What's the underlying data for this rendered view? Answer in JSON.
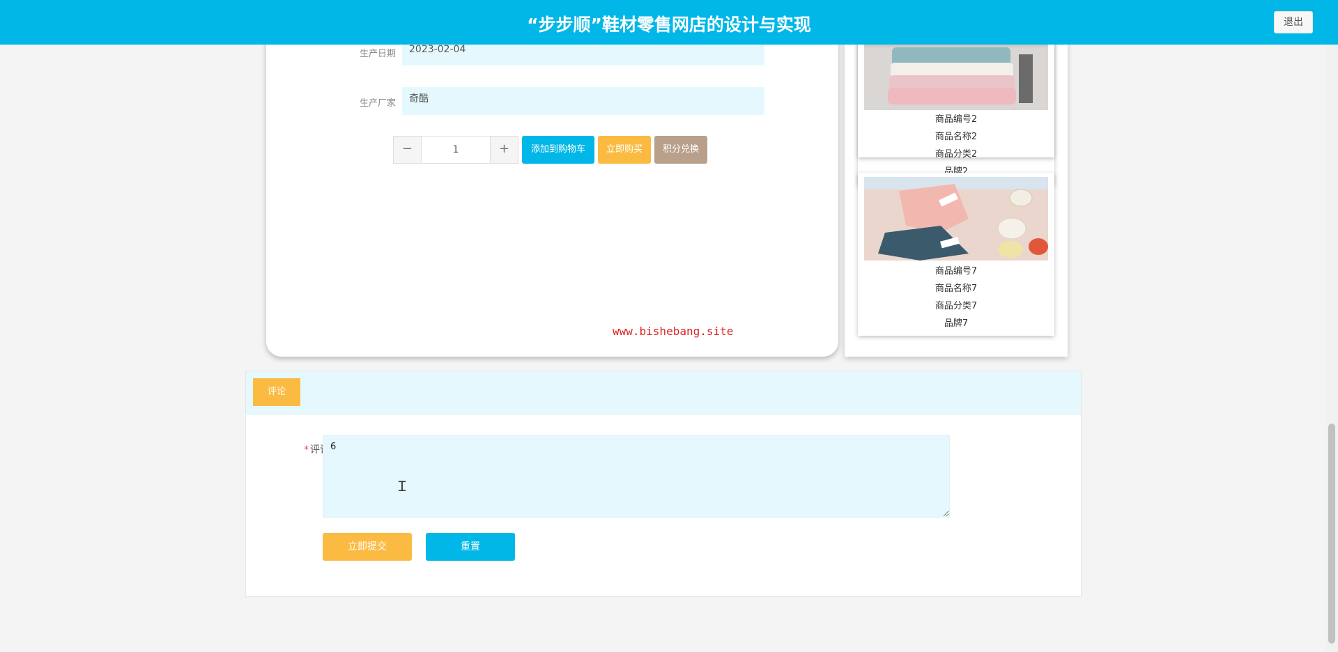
{
  "header": {
    "title": "“步步顺”鞋材零售网店的设计与实现",
    "logout_label": "退出",
    "background_color": "#00b7e8"
  },
  "product_detail": {
    "fields": [
      {
        "label": "生产日期",
        "value": "2023-02-04"
      },
      {
        "label": "生产厂家",
        "value": "奇酷"
      }
    ],
    "quantity": "1",
    "quantity_minus": "−",
    "quantity_plus": "+",
    "add_to_cart_label": "添加到购物车",
    "buy_now_label": "立即购买",
    "points_exchange_label": "积分兑换",
    "watermark": "www.bishebang.site"
  },
  "recommendations": [
    {
      "image": "towels-image",
      "lines": [
        "商品编号2",
        "商品名称2",
        "商品分类2",
        "品牌2"
      ]
    },
    {
      "image": "kitchen-tools-image",
      "lines": [
        "商品编号7",
        "商品名称7",
        "商品分类7",
        "品牌7"
      ]
    }
  ],
  "comment": {
    "tab_label": "评论",
    "field_label": "评论",
    "required_mark": "*",
    "value": "6",
    "submit_label": "立即提交",
    "reset_label": "重置"
  },
  "colors": {
    "primary": "#00b7e8",
    "accent": "#fbbb42",
    "secondary": "#b8a08a",
    "input_bg": "#e5f8fd"
  }
}
